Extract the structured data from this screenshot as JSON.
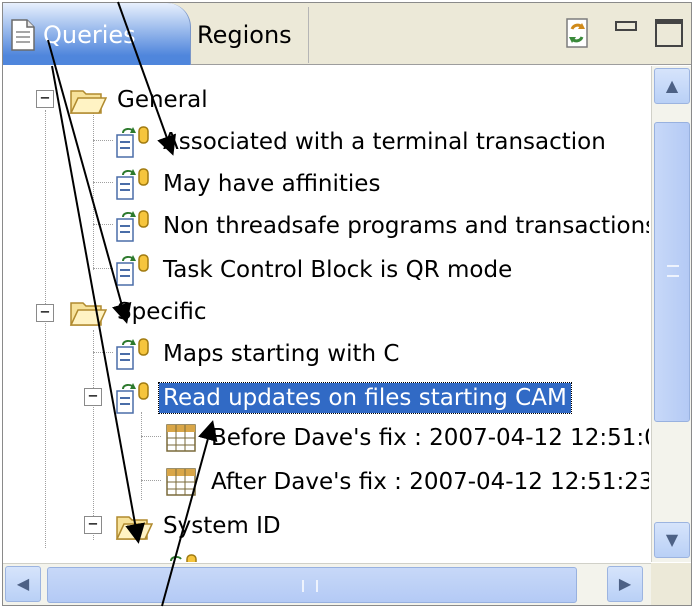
{
  "tabs": {
    "active": "Queries",
    "inactive": "Regions"
  },
  "tree": {
    "general": {
      "label": "General",
      "items": [
        "Associated with a terminal transaction",
        "May have affinities",
        "Non threadsafe programs and transactions",
        "Task Control Block is QR mode"
      ]
    },
    "specific": {
      "label": "Specific",
      "items": [
        "Maps starting with C",
        "Read updates on files starting CAM"
      ],
      "results": [
        "Before Dave's fix : 2007-04-12 12:51:0",
        "After Dave's fix : 2007-04-12 12:51:23"
      ]
    },
    "system_id": {
      "label": "System ID"
    }
  },
  "icons": {
    "queries_tab": "document-icon",
    "sync": "sync-icon",
    "minimize": "minimize-icon",
    "maximize": "maximize-icon",
    "folder": "folder-open-icon",
    "query": "query-icon",
    "result": "table-icon"
  },
  "colors": {
    "selection": "#316ac5",
    "tab_active": "#4f86dc",
    "scrollbar": "#b9d0f6"
  }
}
